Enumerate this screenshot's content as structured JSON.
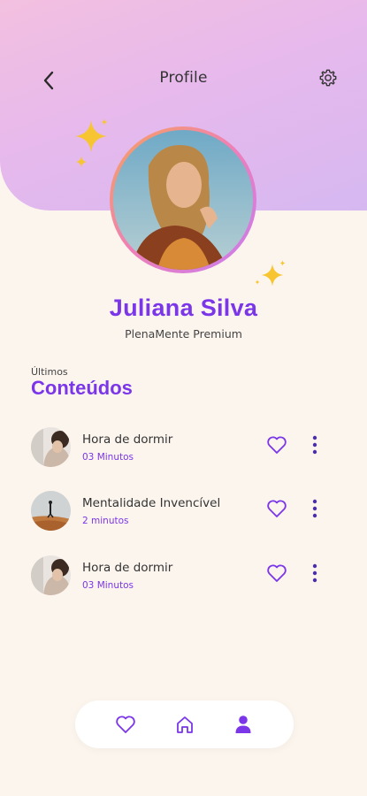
{
  "header": {
    "title": "Profile",
    "back_icon": "chevron-left-icon",
    "settings_icon": "gear-icon"
  },
  "profile": {
    "name": "Juliana Silva",
    "plan": "PlenaMente Premium"
  },
  "section": {
    "label_small": "Últimos",
    "label_title": "Conteúdos"
  },
  "contents": [
    {
      "title": "Hora de dormir",
      "duration": "03 Minutos"
    },
    {
      "title": "Mentalidade Invencível",
      "duration": "2 minutos"
    },
    {
      "title": "Hora de dormir",
      "duration": "03 Minutos"
    }
  ],
  "nav": {
    "items": [
      "heart-icon",
      "home-icon",
      "user-icon"
    ],
    "active": "user-icon"
  },
  "colors": {
    "accent": "#7a36e8",
    "background": "#fcf5ee",
    "sparkle": "#f7c531"
  }
}
